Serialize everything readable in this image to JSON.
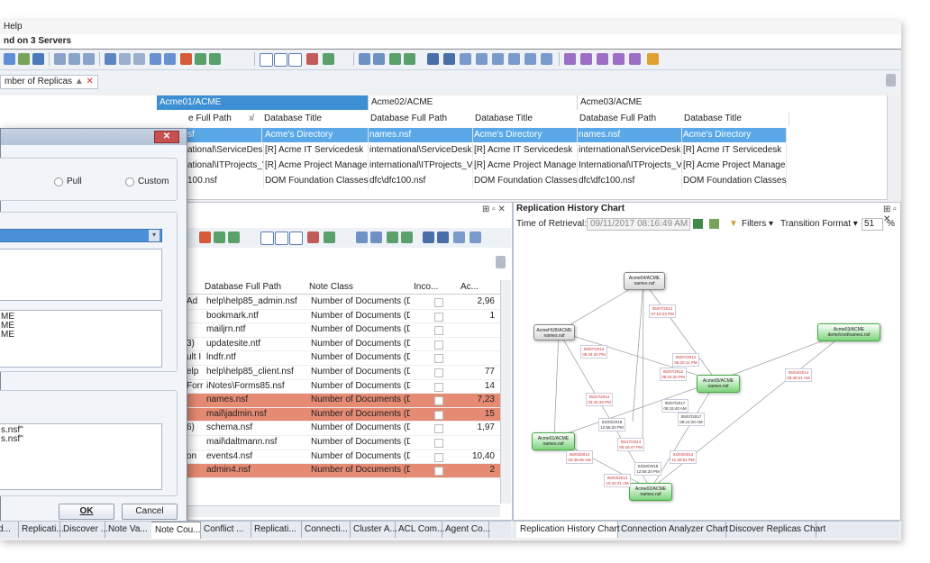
{
  "menu": {
    "help": "Help"
  },
  "window": {
    "title": "nd on 3 Servers"
  },
  "filter_chip": {
    "label": "mber of Replicas"
  },
  "servers": [
    "Acme01/ACME",
    "Acme02/ACME",
    "Acme03/ACME"
  ],
  "grid": {
    "headers": [
      "e Full Path",
      "Database Title",
      "Database Full Path",
      "Database Title",
      "Database Full Path",
      "Database Title"
    ],
    "rows": [
      [
        "sf",
        "Acme's Directory",
        "names.nsf",
        "Acme's Directory",
        "names.nsf",
        "Acme's Directory"
      ],
      [
        "ational\\ServiceDesk.n",
        "[R] Acme IT Servicedesk",
        "international\\ServiceDesk.n",
        "[R] Acme IT Servicedesk",
        "international\\ServiceDesk.n",
        "[R] Acme IT Servicedesk"
      ],
      [
        "ational\\ITProjects_V1.",
        "[R] Acme Project Managem",
        "international\\ITProjects_V1.",
        "[R] Acme Project Managem",
        "International\\ITProjects_V1.",
        "[R] Acme Project Managem"
      ],
      [
        "100.nsf",
        "DOM Foundation Classes 1.",
        "dfc\\dfc100.nsf",
        "DOM Foundation Classes 1.",
        "dfc\\dfc100.nsf",
        "DOM Foundation Classes 1."
      ]
    ]
  },
  "notes_panel": {
    "headers": [
      "Database Full Path",
      "Note Class",
      "Inco...",
      "Ac..."
    ],
    "rows": [
      {
        "prefix": "Ad",
        "path": "help\\help85_admin.nsf",
        "cls": "Number of Documents (Dat",
        "val": "2,96",
        "hl": false
      },
      {
        "prefix": "",
        "path": "bookmark.ntf",
        "cls": "Number of Documents (Dat",
        "val": "1",
        "hl": false
      },
      {
        "prefix": "",
        "path": "mailjrn.ntf",
        "cls": "Number of Documents (Dat",
        "val": "",
        "hl": false
      },
      {
        "prefix": "3)",
        "path": "updatesite.ntf",
        "cls": "Number of Documents (Dat",
        "val": "",
        "hl": false
      },
      {
        "prefix": "ult I",
        "path": "lndfr.ntf",
        "cls": "Number of Documents (Dat",
        "val": "",
        "hl": false
      },
      {
        "prefix": "elp",
        "path": "help\\help85_client.nsf",
        "cls": "Number of Documents (Dat",
        "val": "77",
        "hl": false
      },
      {
        "prefix": "Forr",
        "path": "iNotes\\Forms85.nsf",
        "cls": "Number of Documents (Dat",
        "val": "14",
        "hl": false
      },
      {
        "prefix": "",
        "path": "names.nsf",
        "cls": "Number of Documents (Dat",
        "val": "7,23",
        "hl": true
      },
      {
        "prefix": "",
        "path": "mail\\jadmin.nsf",
        "cls": "Number of Documents (Dat",
        "val": "15",
        "hl": true
      },
      {
        "prefix": "6)",
        "path": "schema.nsf",
        "cls": "Number of Documents (Dat",
        "val": "1,97",
        "hl": false
      },
      {
        "prefix": "",
        "path": "mail\\daltmann.nsf",
        "cls": "Number of Documents (Dat",
        "val": "",
        "hl": false
      },
      {
        "prefix": "on",
        "path": "events4.nsf",
        "cls": "Number of Documents (Dat",
        "val": "10,40",
        "hl": false
      },
      {
        "prefix": "",
        "path": "admin4.nsf",
        "cls": "Number of Documents (Dat",
        "val": "2",
        "hl": true
      }
    ]
  },
  "chart_panel": {
    "title": "Replication History Chart",
    "retrieval_label": "Time of Retrieval:",
    "retrieval_value": "09/11/2017 08:16:49 AM",
    "filters": "Filters",
    "transition": "Transition Format",
    "zoom": "51",
    "zoom_unit": "%",
    "nodes": [
      {
        "l1": "Acme04/ACME",
        "l2": "names.nsf"
      },
      {
        "l1": "AcmeHUB/ACME",
        "l2": "names.nsf"
      },
      {
        "l1": "Acme05/ACME",
        "l2": "names.nsf"
      },
      {
        "l1": "Acme01/ACME",
        "l2": "names.nsf"
      },
      {
        "l1": "Acme02/ACME",
        "l2": "names.nsf"
      },
      {
        "l1": "Acme03/ACME",
        "l2": "demo\\root\\names.nsf"
      }
    ],
    "edges": [
      {
        "d": "05/07/2012",
        "t": "07:10:23 PM"
      },
      {
        "d": "05/07/2012",
        "t": "06:44:20 PM"
      },
      {
        "d": "05/07/2012",
        "t": "06:20:11 PM"
      },
      {
        "d": "05/07/2012",
        "t": "06:44:20 PM"
      },
      {
        "d": "05/27/2014",
        "t": "03:40:49 PM"
      },
      {
        "d": "05/07/2017",
        "t": "08:15:40 AM"
      },
      {
        "d": "05/07/2017",
        "t": "08:12:20 AM"
      },
      {
        "d": "03/20/2018",
        "t": "12:58:20 PM"
      },
      {
        "d": "05/04/2014",
        "t": "05:48:21 AM"
      },
      {
        "d": "05/17/2014",
        "t": "05:40:47 PM"
      },
      {
        "d": "05/03/2014",
        "t": "02:49:45 AM"
      },
      {
        "d": "04/03/2014",
        "t": "11:40:51 PM"
      },
      {
        "d": "03/20/2018",
        "t": "12:58:20 PM"
      },
      {
        "d": "06/03/2014",
        "t": "10:42:31 AM"
      }
    ]
  },
  "dialog": {
    "radio_pull": "Pull",
    "radio_custom": "Custom",
    "list1": [
      "ME",
      "ME",
      "ME"
    ],
    "list2": [
      "s.nsf\"",
      "s.nsf\""
    ],
    "ok": "OK",
    "cancel": "Cancel"
  },
  "bottom_tabs_left": [
    "d...",
    "Replicati...",
    "Discover ...",
    "Note Va...",
    "Note Cou...",
    "Conflict ...",
    "Replicati...",
    "Connecti...",
    "Cluster A...",
    "ACL Com...",
    "Agent Co..."
  ],
  "bottom_tabs_right": [
    "Replication History Chart",
    "Connection Analyzer Chart",
    "Discover Replicas Chart"
  ]
}
